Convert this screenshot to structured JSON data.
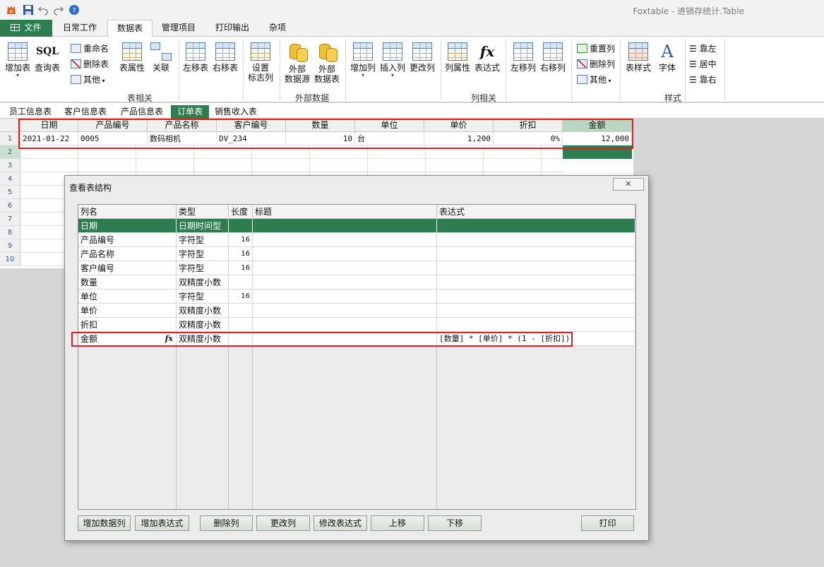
{
  "app": {
    "title": "Foxtable - 进销存统计.Table"
  },
  "ribbon_tabs": [
    {
      "label": "文件"
    },
    {
      "label": "日常工作"
    },
    {
      "label": "数据表"
    },
    {
      "label": "管理项目"
    },
    {
      "label": "打印输出"
    },
    {
      "label": "杂项"
    }
  ],
  "ribbon": {
    "table_group": {
      "add_table": "增加表",
      "query_table": "查询表",
      "sql_icon": "SQL",
      "rename": "重命名",
      "delete_table": "删除表",
      "other": "其他",
      "table_props": "表属性",
      "relation": "关联",
      "move_left": "左移表",
      "move_right": "右移表",
      "flag_col_1": "设置",
      "flag_col_2": "标志列",
      "label": "表相关"
    },
    "external_group": {
      "ext_source_1": "外部",
      "ext_source_2": "数据源",
      "ext_table_1": "外部",
      "ext_table_2": "数据表",
      "label": "外部数据"
    },
    "column_group": {
      "add_col": "增加列",
      "insert_col": "插入列",
      "modify_col": "更改列",
      "col_props": "列属性",
      "expression": "表达式",
      "fx_icon": "fx",
      "col_left": "左移列",
      "col_right": "右移列",
      "reset_col": "重置列",
      "delete_col": "删除列",
      "other": "其他",
      "label": "列相关"
    },
    "style_group": {
      "table_style": "表样式",
      "font": "字体",
      "font_icon": "A",
      "align_left": "靠左",
      "align_center": "居中",
      "align_right": "靠右",
      "label": "样式"
    }
  },
  "sheet_tabs": [
    {
      "label": "员工信息表"
    },
    {
      "label": "客户信息表"
    },
    {
      "label": "产品信息表"
    },
    {
      "label": "订单表"
    },
    {
      "label": "销售收入表"
    }
  ],
  "sheet": {
    "columns": [
      "日期",
      "产品编号",
      "产品名称",
      "客户编号",
      "数量",
      "单位",
      "单价",
      "折扣",
      "金额"
    ],
    "row_numbers": [
      "1",
      "2",
      "3",
      "4",
      "5",
      "6",
      "7",
      "8",
      "9",
      "10"
    ],
    "row1": [
      "2021-01-22",
      "0005",
      "数码相机",
      "DV_234",
      "10",
      "台",
      "1,200",
      "0%",
      "12,000"
    ]
  },
  "dialog": {
    "title": "查看表结构",
    "close_glyph": "✕",
    "headers": [
      "列名",
      "类型",
      "长度",
      "标题",
      "表达式"
    ],
    "rows": [
      {
        "name": "日期",
        "type": "日期时间型",
        "length": "",
        "caption": "",
        "expr": ""
      },
      {
        "name": "产品编号",
        "type": "字符型",
        "length": "16",
        "caption": "",
        "expr": ""
      },
      {
        "name": "产品名称",
        "type": "字符型",
        "length": "16",
        "caption": "",
        "expr": ""
      },
      {
        "name": "客户编号",
        "type": "字符型",
        "length": "16",
        "caption": "",
        "expr": ""
      },
      {
        "name": "数量",
        "type": "双精度小数",
        "length": "",
        "caption": "",
        "expr": ""
      },
      {
        "name": "单位",
        "type": "字符型",
        "length": "16",
        "caption": "",
        "expr": ""
      },
      {
        "name": "单价",
        "type": "双精度小数",
        "length": "",
        "caption": "",
        "expr": ""
      },
      {
        "name": "折扣",
        "type": "双精度小数",
        "length": "",
        "caption": "",
        "expr": ""
      },
      {
        "name": "金额",
        "type": "双精度小数",
        "length": "",
        "caption": "",
        "expr": "[数量] * [单价] * (1 - [折扣])",
        "fx": "fx"
      }
    ],
    "buttons": [
      "增加数据列",
      "增加表达式",
      "删除列",
      "更改列",
      "修改表达式",
      "上移",
      "下移"
    ],
    "print_button": "打印"
  }
}
